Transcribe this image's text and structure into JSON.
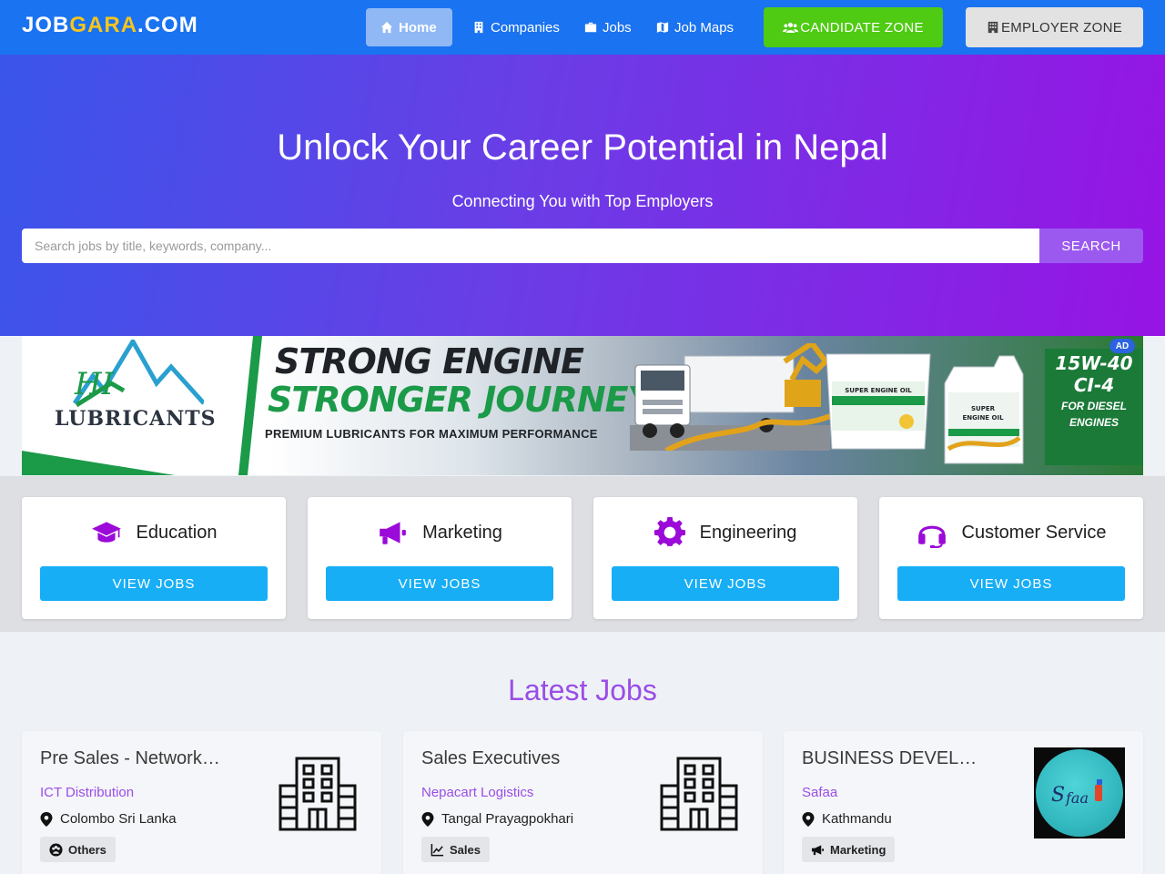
{
  "nav": {
    "brand": {
      "part1": "JOB",
      "part2": "GARA",
      "part3": ".COM"
    },
    "links": [
      {
        "label": "Home",
        "icon": "home-icon",
        "active": true
      },
      {
        "label": "Companies",
        "icon": "building-icon",
        "active": false
      },
      {
        "label": "Jobs",
        "icon": "briefcase-icon",
        "active": false
      },
      {
        "label": "Job Maps",
        "icon": "map-icon",
        "active": false
      }
    ],
    "candidate_zone": "CANDIDATE ZONE",
    "employer_zone": "EMPLOYER ZONE"
  },
  "hero": {
    "title": "Unlock Your Career Potential in Nepal",
    "subtitle": "Connecting You with Top Employers",
    "search_placeholder": "Search jobs by title, keywords, company...",
    "search_button": "SEARCH"
  },
  "ad": {
    "brand": "LUBRICANTS",
    "headline1": "STRONG ENGINE",
    "headline2": "STRONGER JOURNEY.",
    "tagline": "PREMIUM LUBRICANTS FOR MAXIMUM PERFORMANCE",
    "spec_line1": "15W-40",
    "spec_line2": "CI-4",
    "diesel_line1": "FOR DIESEL",
    "diesel_line2": "ENGINES",
    "badge": "AD",
    "bucket_label": "SUPER ENGINE OIL",
    "jug_label": "SUPER ENGINE OIL"
  },
  "categories": [
    {
      "name": "Education",
      "icon": "graduation-cap-icon",
      "button": "VIEW JOBS"
    },
    {
      "name": "Marketing",
      "icon": "megaphone-icon",
      "button": "VIEW JOBS"
    },
    {
      "name": "Engineering",
      "icon": "gear-icon",
      "button": "VIEW JOBS"
    },
    {
      "name": "Customer Service",
      "icon": "headset-icon",
      "button": "VIEW JOBS"
    }
  ],
  "latest": {
    "title": "Latest Jobs",
    "jobs": [
      {
        "title": "Pre Sales - Networking",
        "company": "ICT Distribution",
        "location": "Colombo Sri Lanka",
        "category": "Others",
        "category_icon": "group-icon",
        "logo": "building-icon"
      },
      {
        "title": "Sales Executives",
        "company": "Nepacart Logistics",
        "location": "Tangal Prayagpokhari",
        "category": "Sales",
        "category_icon": "chart-line-icon",
        "logo": "building-icon"
      },
      {
        "title": "BUSINESS DEVELOPMENT",
        "company": "Safaa",
        "location": "Kathmandu",
        "category": "Marketing",
        "category_icon": "megaphone-icon",
        "logo": "safaa-logo"
      }
    ]
  },
  "colors": {
    "nav_bg": "#1a73f0",
    "brand_highlight": "#f7c51e",
    "candidate_btn": "#4ecb12",
    "employer_btn": "#e2e2e2",
    "hero_start": "#3a55ea",
    "hero_end": "#9714e4",
    "accent_purple": "#9b4de6",
    "category_icon": "#9b0ad8",
    "view_jobs_btn": "#17aef5"
  }
}
